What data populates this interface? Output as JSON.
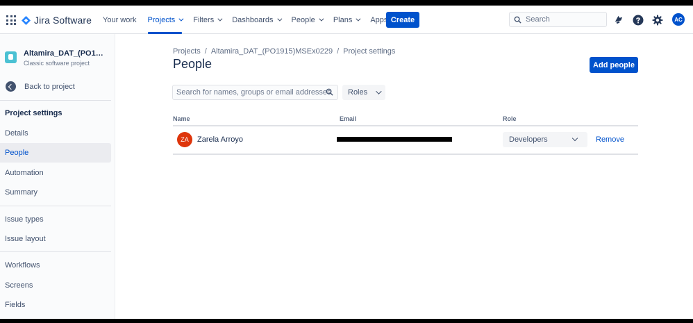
{
  "nav": {
    "product_name": "Jira Software",
    "menu": [
      {
        "label": "Your work",
        "dropdown": false,
        "active": false
      },
      {
        "label": "Projects",
        "dropdown": true,
        "active": true
      },
      {
        "label": "Filters",
        "dropdown": true,
        "active": false
      },
      {
        "label": "Dashboards",
        "dropdown": true,
        "active": false
      },
      {
        "label": "People",
        "dropdown": true,
        "active": false
      },
      {
        "label": "Plans",
        "dropdown": true,
        "active": false
      },
      {
        "label": "Apps",
        "dropdown": true,
        "active": false
      }
    ],
    "create_label": "Create",
    "search_placeholder": "Search",
    "avatar_initials": "AC",
    "icons": [
      "notifications-icon",
      "help-icon",
      "settings-icon"
    ]
  },
  "sidebar": {
    "project_name": "Altamira_DAT_(PO1915)MSEx0229",
    "project_type": "Classic software project",
    "back_label": "Back to project",
    "heading": "Project settings",
    "items": [
      {
        "label": "Details",
        "active": false
      },
      {
        "label": "People",
        "active": true
      },
      {
        "label": "Automation",
        "active": false
      },
      {
        "label": "Summary",
        "active": false
      },
      {
        "label": "Issue types",
        "active": false
      },
      {
        "label": "Issue layout",
        "active": false
      },
      {
        "label": "Workflows",
        "active": false
      },
      {
        "label": "Screens",
        "active": false
      },
      {
        "label": "Fields",
        "active": false
      }
    ]
  },
  "main": {
    "breadcrumbs": [
      "Projects",
      "Altamira_DAT_(PO1915)MSEx0229",
      "Project settings"
    ],
    "title": "People",
    "add_people_label": "Add people",
    "search_placeholder": "Search for names, groups or email addresses",
    "roles_filter_label": "Roles",
    "table": {
      "headers": {
        "name": "Name",
        "email": "Email",
        "role": "Role"
      },
      "rows": [
        {
          "initials": "ZA",
          "name": "Zarela Arroyo",
          "email": "",
          "role": "Developers",
          "action": "Remove"
        }
      ]
    }
  },
  "colors": {
    "brand_blue": "#0052cc",
    "avatar_red": "#de350b",
    "project_icon": "#4bc1d3"
  }
}
